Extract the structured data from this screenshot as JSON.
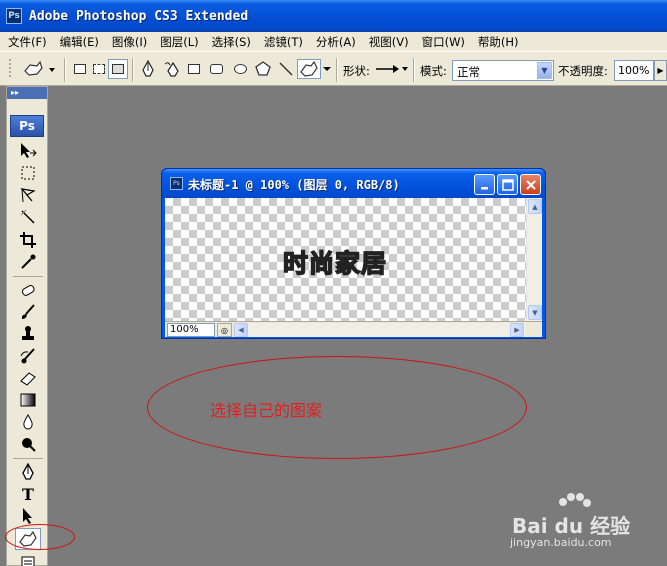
{
  "app": {
    "title": "Adobe Photoshop CS3 Extended",
    "icon": "Ps"
  },
  "menu": [
    "文件(F)",
    "编辑(E)",
    "图像(I)",
    "图层(L)",
    "选择(S)",
    "滤镜(T)",
    "分析(A)",
    "视图(V)",
    "窗口(W)",
    "帮助(H)"
  ],
  "options": {
    "shape_label": "形状:",
    "mode_label": "模式:",
    "mode_value": "正常",
    "opacity_label": "不透明度:",
    "opacity_value": "100%"
  },
  "toolbox": {
    "logo": "Ps",
    "type_tool": "T"
  },
  "document": {
    "title": "未标题-1 @ 100% (图层 0, RGB/8)",
    "icon": "Ps",
    "canvas_text": "时尚家居",
    "zoom": "100%"
  },
  "annotation": {
    "text": "选择自己的图案"
  },
  "watermark": {
    "logo": "Bai du 经验",
    "url": "jingyan.baidu.com"
  },
  "colors": {
    "annotation_red": "#d01010",
    "workspace_gray": "#7b7b7b",
    "xp_blue": "#0451d6"
  }
}
